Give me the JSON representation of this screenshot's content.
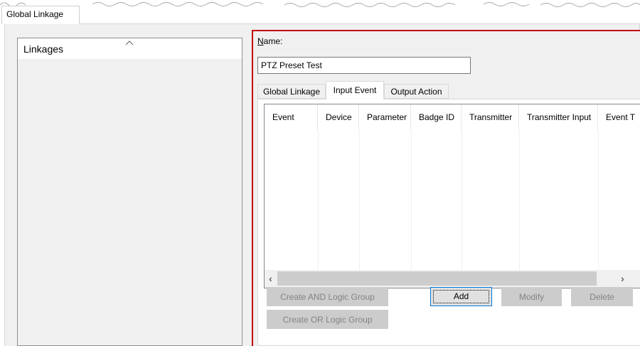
{
  "outer_tab": {
    "label": "Global Linkage"
  },
  "linkages": {
    "header": "Linkages"
  },
  "detail": {
    "name_label_accel": "N",
    "name_label_rest": "ame:",
    "name_value": "PTZ Preset Test",
    "tabs": [
      {
        "label": "Global Linkage"
      },
      {
        "label": "Input Event",
        "selected": true
      },
      {
        "label": "Output Action"
      }
    ],
    "table": {
      "columns": [
        "Event",
        "Device",
        "Parameter",
        "Badge ID",
        "Transmitter",
        "Transmitter Input",
        "Event T"
      ],
      "rows": []
    },
    "buttons": {
      "create_and": "Create AND Logic Group",
      "create_or": "Create OR Logic Group",
      "add": "Add",
      "modify": "Modify",
      "delete": "Delete"
    }
  },
  "colors": {
    "panel_border": "#c00000",
    "focus_border": "#0078d7",
    "disabled_button_bg": "#cccccc",
    "disabled_text": "#838383"
  },
  "icons": {
    "sort": "caret-up",
    "scroll_left": "chevron-left",
    "scroll_right": "chevron-right"
  }
}
